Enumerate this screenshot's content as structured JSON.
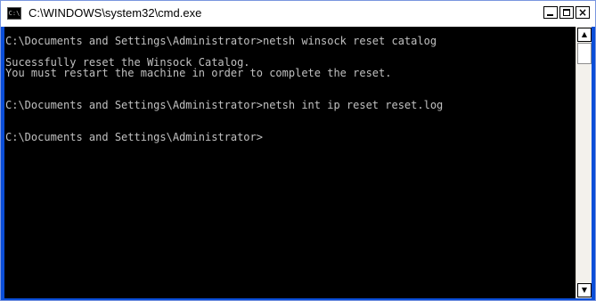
{
  "window": {
    "title": "C:\\WINDOWS\\system32\\cmd.exe",
    "app_icon": "console-icon",
    "icon_glyph": "C:\\"
  },
  "title_buttons": {
    "minimize": "minimize-icon",
    "maximize": "maximize-icon",
    "close": "close-icon",
    "close_glyph": "×"
  },
  "console": {
    "lines": [
      "C:\\Documents and Settings\\Administrator>netsh winsock reset catalog",
      "",
      "Sucessfully reset the Winsock Catalog.",
      "You must restart the machine in order to complete the reset.",
      "",
      "",
      "C:\\Documents and Settings\\Administrator>netsh int ip reset reset.log",
      "",
      "",
      "C:\\Documents and Settings\\Administrator>"
    ]
  },
  "scrollbar": {
    "up_glyph": "▲",
    "down_glyph": "▼"
  },
  "colors": {
    "console_background": "#000000",
    "console_text": "#c0c0c0",
    "window_frame": "#0a4ed8"
  }
}
